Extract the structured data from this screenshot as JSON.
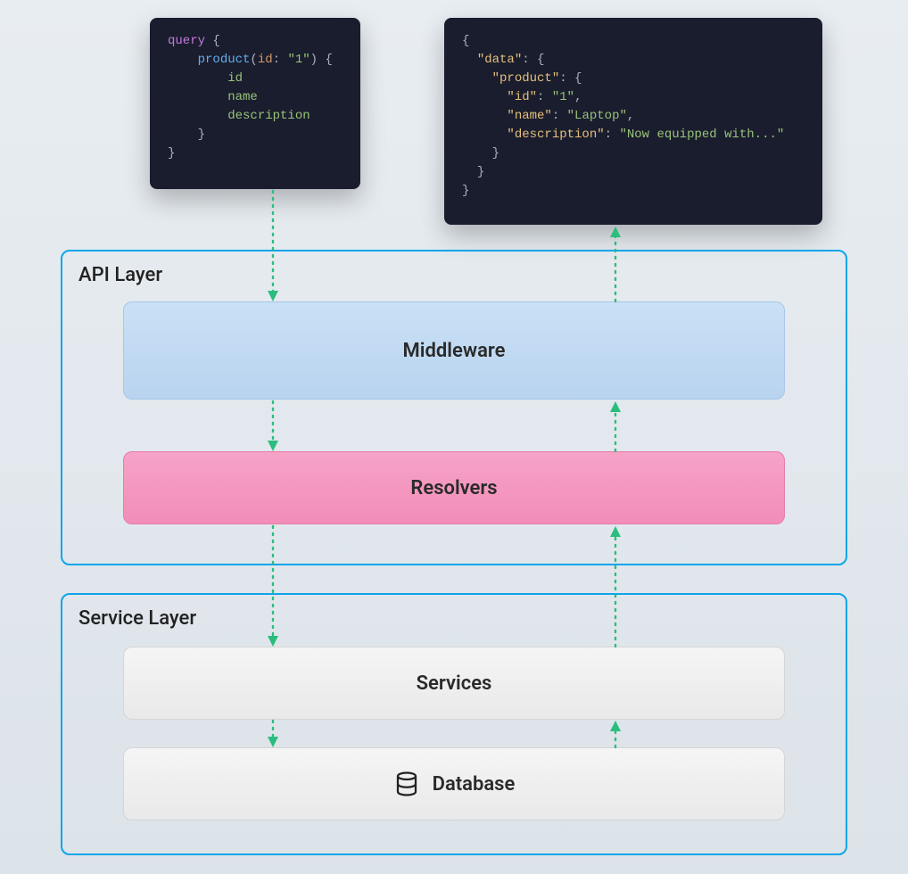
{
  "query": {
    "keyword": "query",
    "open": "{",
    "fn": "product",
    "paren_open": "(",
    "arg_name": "id",
    "colon": ":",
    "arg_val": "\"1\"",
    "paren_close": ")",
    "open2": "{",
    "fields": [
      "id",
      "name",
      "description"
    ],
    "close2": "}",
    "close": "}"
  },
  "response": {
    "open": "{",
    "data_key": "\"data\"",
    "product_key": "\"product\"",
    "id_key": "\"id\"",
    "id_val": "\"1\"",
    "name_key": "\"name\"",
    "name_val": "\"Laptop\"",
    "desc_key": "\"description\"",
    "desc_val": "\"Now equipped with...\"",
    "close": "}",
    "colon": ":",
    "comma": ","
  },
  "layers": {
    "api_title": "API Layer",
    "service_title": "Service Layer",
    "middleware": "Middleware",
    "resolvers": "Resolvers",
    "services": "Services",
    "database": "Database"
  }
}
